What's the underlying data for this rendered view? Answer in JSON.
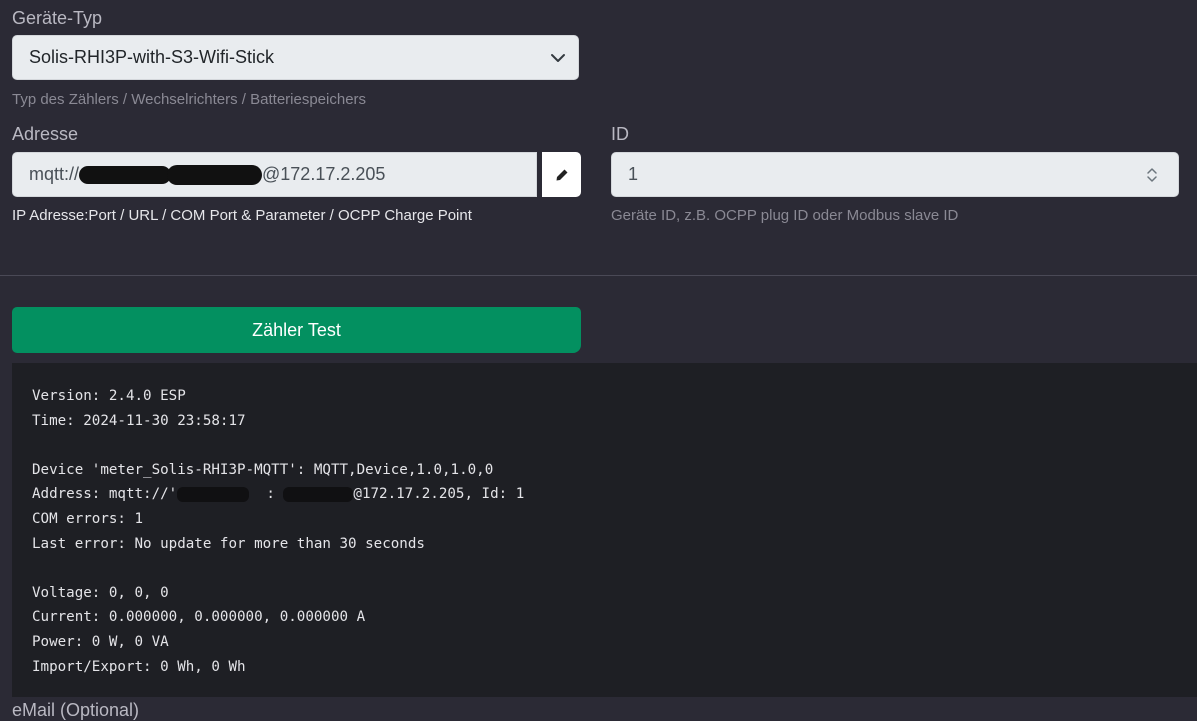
{
  "device_type": {
    "label": "Geräte-Typ",
    "selected": "Solis-RHI3P-with-S3-Wifi-Stick",
    "hint": "Typ des Zählers / Wechselrichters / Batteriespeichers"
  },
  "address": {
    "label": "Adresse",
    "value_prefix": "mqtt://",
    "value_suffix": "@172.17.2.205",
    "hint": "IP Adresse:Port / URL / COM Port & Parameter / OCPP Charge Point"
  },
  "device_id": {
    "label": "ID",
    "value": "1",
    "hint": "Geräte ID, z.B. OCPP plug ID oder Modbus slave ID"
  },
  "test_button": {
    "label": "Zähler Test"
  },
  "console": {
    "version": "Version: 2.4.0 ESP",
    "time": "Time: 2024-11-30 23:58:17",
    "device": "Device 'meter_Solis-RHI3P-MQTT': MQTT,Device,1.0,1.0,0",
    "address_prefix": "Address: mqtt://'",
    "address_mid": ":",
    "address_suffix": "@172.17.2.205, Id: 1",
    "com_errors": "COM errors: 1",
    "last_error": "Last error: No update for more than 30 seconds",
    "voltage": "Voltage: 0, 0, 0",
    "current": "Current: 0.000000, 0.000000, 0.000000 A",
    "power": "Power: 0 W, 0 VA",
    "import_export": "Import/Export: 0 Wh, 0 Wh"
  },
  "email": {
    "label": "eMail (Optional)"
  },
  "icons": {
    "select_arrow": "chevron-down-icon",
    "edit": "pencil-icon",
    "spinner": "up-down-arrows-icon"
  }
}
